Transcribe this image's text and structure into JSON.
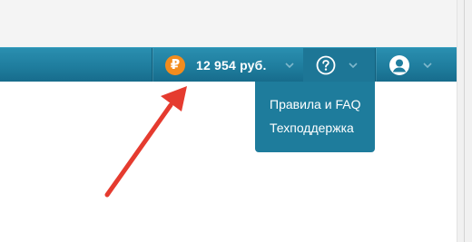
{
  "header": {
    "balance": {
      "currency_symbol": "₽",
      "amount_text": "12 954 руб."
    },
    "help_menu": {
      "items": [
        {
          "label": "Правила и FAQ"
        },
        {
          "label": "Техподдержка"
        }
      ]
    }
  },
  "colors": {
    "navbar": "#1f7d9e",
    "dropdown": "#1e7c9c",
    "ruble_badge": "#f28c1e",
    "annotation_arrow": "#e53b2f"
  },
  "icons": [
    "ruble-icon",
    "chevron-down-icon",
    "help-icon",
    "user-icon"
  ]
}
